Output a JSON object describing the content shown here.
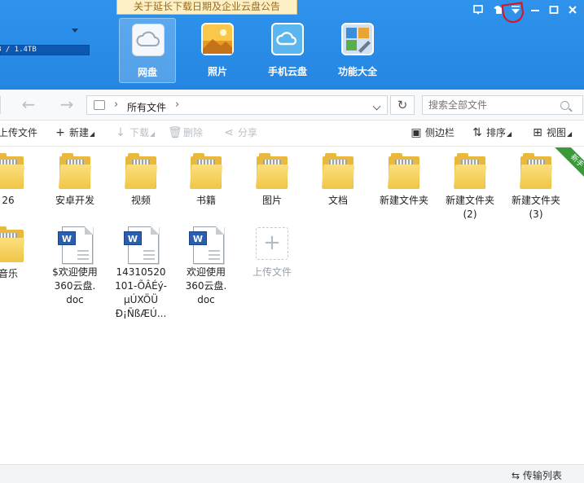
{
  "header": {
    "notice": "关于延长下载日期及企业云盘公告",
    "storage_text": "B / 1.4TB",
    "nav": [
      {
        "label": "网盘",
        "icon": "cloud-disk-icon",
        "active": true
      },
      {
        "label": "照片",
        "icon": "photo-icon"
      },
      {
        "label": "手机云盘",
        "icon": "mobile-cloud-icon"
      },
      {
        "label": "功能大全",
        "icon": "toolbox-icon"
      }
    ],
    "window_controls": [
      "feedback-icon",
      "skin-icon",
      "menu-dropdown-icon",
      "minimize-icon",
      "maximize-icon",
      "close-icon"
    ],
    "accent": "#2b8ce8"
  },
  "navbar": {
    "back_glyph": "←",
    "forward_glyph": "→",
    "crumb_sep": "›",
    "crumb": "所有文件",
    "refresh_glyph": "↻",
    "search_placeholder": "搜索全部文件"
  },
  "toolbar": {
    "upload": "上传文件",
    "new": "新建",
    "download": "下载",
    "delete": "删除",
    "share": "分享",
    "sidebar": "侧边栏",
    "sort": "排序",
    "view": "视图",
    "new_glyph": "+",
    "download_glyph": "↓",
    "delete_glyph": "🗑",
    "share_glyph": "⋖",
    "sidebar_glyph": "▣",
    "sort_glyph": "⇅",
    "view_glyph": "⊞",
    "small_arrow": "◢"
  },
  "files": [
    {
      "name": "26",
      "type": "folder"
    },
    {
      "name": "安卓开发",
      "type": "folder"
    },
    {
      "name": "视频",
      "type": "folder"
    },
    {
      "name": "书籍",
      "type": "folder"
    },
    {
      "name": "图片",
      "type": "folder"
    },
    {
      "name": "文档",
      "type": "folder"
    },
    {
      "name": "新建文件夹",
      "type": "folder"
    },
    {
      "name": "新建文件夹\n(2)",
      "type": "folder"
    },
    {
      "name": "新建文件夹\n(3)",
      "type": "folder"
    },
    {
      "name": "音乐",
      "type": "folder"
    },
    {
      "name": "$欢迎使用\n360云盘.\ndoc",
      "type": "doc"
    },
    {
      "name": "14310520\n101-ÕÂÉý-\nµÚXÖÜ\nÐ¡ÑßÆÚ...",
      "type": "doc"
    },
    {
      "name": "欢迎使用\n360云盘.\ndoc",
      "type": "doc"
    }
  ],
  "upload_tile": {
    "label": "上传文件",
    "glyph": "+"
  },
  "new_badge": "新手",
  "doc_badge": "W",
  "status": {
    "transfer_list": "传输列表",
    "transfer_glyph": "⇆"
  }
}
